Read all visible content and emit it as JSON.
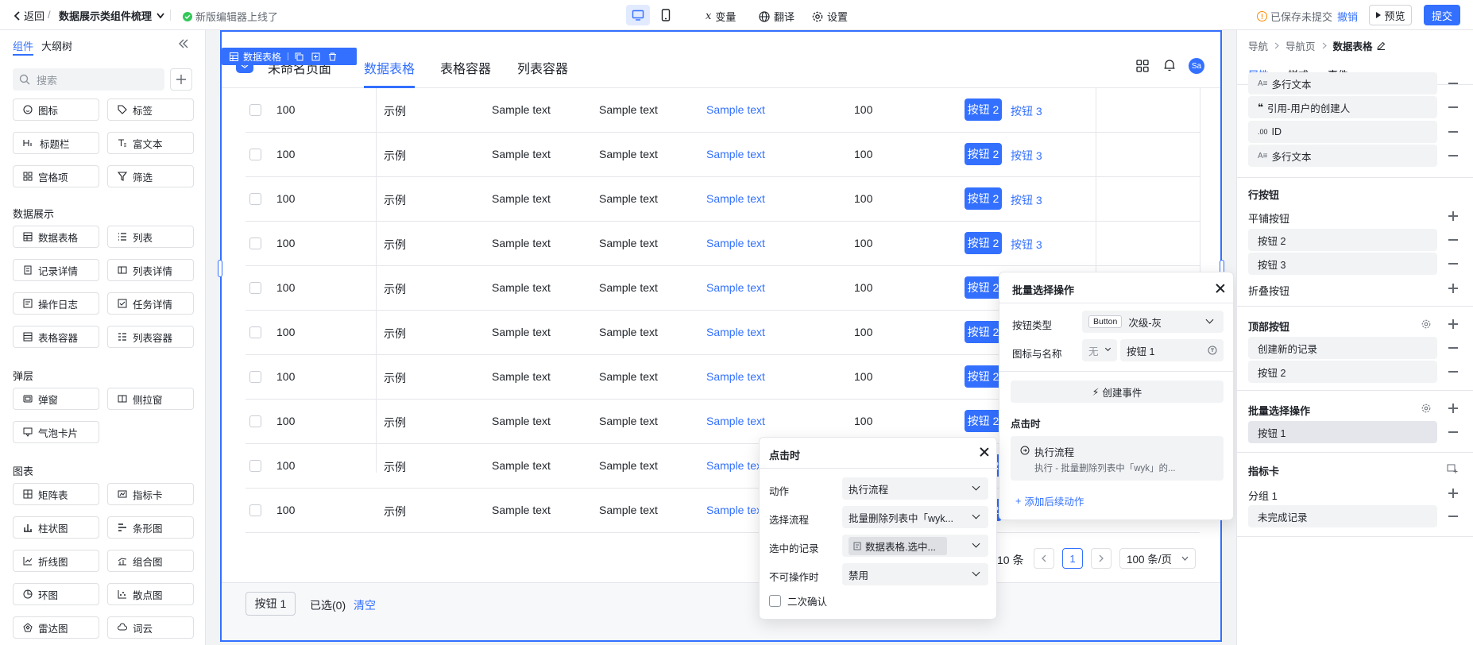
{
  "topbar": {
    "back_label": "返回",
    "separator": "/",
    "page_name": "数据展示类组件梳理",
    "notice": "新版编辑器上线了",
    "variable_label": "变量",
    "translate_label": "翻译",
    "settings_label": "设置",
    "saved_status": "已保存未提交",
    "undo_label": "撤销",
    "preview_label": "预览",
    "submit_label": "提交",
    "accent_color": "#3370ff"
  },
  "left_panel": {
    "tabs": [
      "组件",
      "大纲树"
    ],
    "search_placeholder": "搜索",
    "top_items": [
      "图标",
      "标签",
      "标题栏",
      "富文本",
      "宫格项",
      "筛选"
    ],
    "sections": [
      {
        "title": "数据展示",
        "items": [
          "数据表格",
          "列表",
          "记录详情",
          "列表详情",
          "操作日志",
          "任务详情",
          "表格容器",
          "列表容器"
        ]
      },
      {
        "title": "弹层",
        "items": [
          "弹窗",
          "侧拉窗",
          "气泡卡片"
        ]
      },
      {
        "title": "图表",
        "items": [
          "矩阵表",
          "指标卡",
          "柱状图",
          "条形图",
          "折线图",
          "组合图",
          "环图",
          "散点图",
          "雷达图",
          "词云"
        ]
      }
    ]
  },
  "canvas": {
    "component_tag": "数据表格",
    "page_title": "未命名页面",
    "nav_tabs": [
      "数据表格",
      "表格容器",
      "列表容器"
    ],
    "avatar_text": "Sa",
    "table_rows": [
      [
        "100",
        "示例",
        "Sample text",
        "Sample text",
        "Sample text",
        "100"
      ],
      [
        "100",
        "示例",
        "Sample text",
        "Sample text",
        "Sample text",
        "100"
      ],
      [
        "100",
        "示例",
        "Sample text",
        "Sample text",
        "Sample text",
        "100"
      ],
      [
        "100",
        "示例",
        "Sample text",
        "Sample text",
        "Sample text",
        "100"
      ],
      [
        "100",
        "示例",
        "Sample text",
        "Sample text",
        "Sample text",
        "100"
      ],
      [
        "100",
        "示例",
        "Sample text",
        "Sample text",
        "Sample text",
        "100"
      ],
      [
        "100",
        "示例",
        "Sample text",
        "Sample text",
        "Sample text",
        "100"
      ],
      [
        "100",
        "示例",
        "Sample text",
        "Sample text",
        "Sample text",
        "100"
      ],
      [
        "100",
        "示例",
        "Sample text",
        "Sample text",
        "Sample text",
        "100"
      ],
      [
        "100",
        "示例",
        "Sample text",
        "Sample text",
        "Sample text",
        "100"
      ]
    ],
    "row_action_primary": "按钮 2",
    "row_action_link": "按钮 3",
    "pagination": {
      "total_text": "10 条",
      "current_page": "1",
      "page_size": "100 条/页"
    },
    "footer": {
      "batch_button": "按钮 1",
      "selected_text": "已选(0)",
      "clear_label": "清空"
    }
  },
  "batch_popup": {
    "title": "批量选择操作",
    "button_type_label": "按钮类型",
    "button_type_tag": "Button",
    "button_type_value": "次级-灰",
    "icon_name_label": "图标与名称",
    "icon_value": "无",
    "name_value": "按钮 1",
    "create_event_label": "创建事件",
    "on_click_label": "点击时",
    "flow_title": "执行流程",
    "flow_desc": "执行 - 批量删除列表中「wyk」的...",
    "add_action_label": "添加后续动作"
  },
  "click_popup": {
    "title": "点击时",
    "fields": [
      {
        "label": "动作",
        "value": "执行流程"
      },
      {
        "label": "选择流程",
        "value": "批量删除列表中「wyk..."
      },
      {
        "label": "选中的记录",
        "value": "数据表格.选中..."
      },
      {
        "label": "不可操作时",
        "value": "禁用"
      }
    ],
    "confirm_label": "二次确认"
  },
  "right_panel": {
    "breadcrumb": [
      "导航",
      "导航页",
      "数据表格"
    ],
    "tabs": [
      "属性",
      "样式",
      "事件"
    ],
    "fields": [
      {
        "icon": "A≡",
        "label": "多行文本"
      },
      {
        "icon": "❝",
        "label": "引用-用户的创建人"
      },
      {
        "icon": ".00",
        "label": "ID"
      },
      {
        "icon": "A≡",
        "label": "多行文本"
      }
    ],
    "row_buttons_title": "行按钮",
    "tiled_buttons_label": "平铺按钮",
    "tiled_buttons": [
      "按钮 2",
      "按钮 3"
    ],
    "folded_buttons_label": "折叠按钮",
    "top_buttons_title": "顶部按钮",
    "top_buttons": [
      "创建新的记录",
      "按钮 2"
    ],
    "batch_title": "批量选择操作",
    "batch_buttons": [
      "按钮 1"
    ],
    "metric_title": "指标卡",
    "group_label": "分组 1",
    "group_items": [
      "未完成记录"
    ]
  }
}
